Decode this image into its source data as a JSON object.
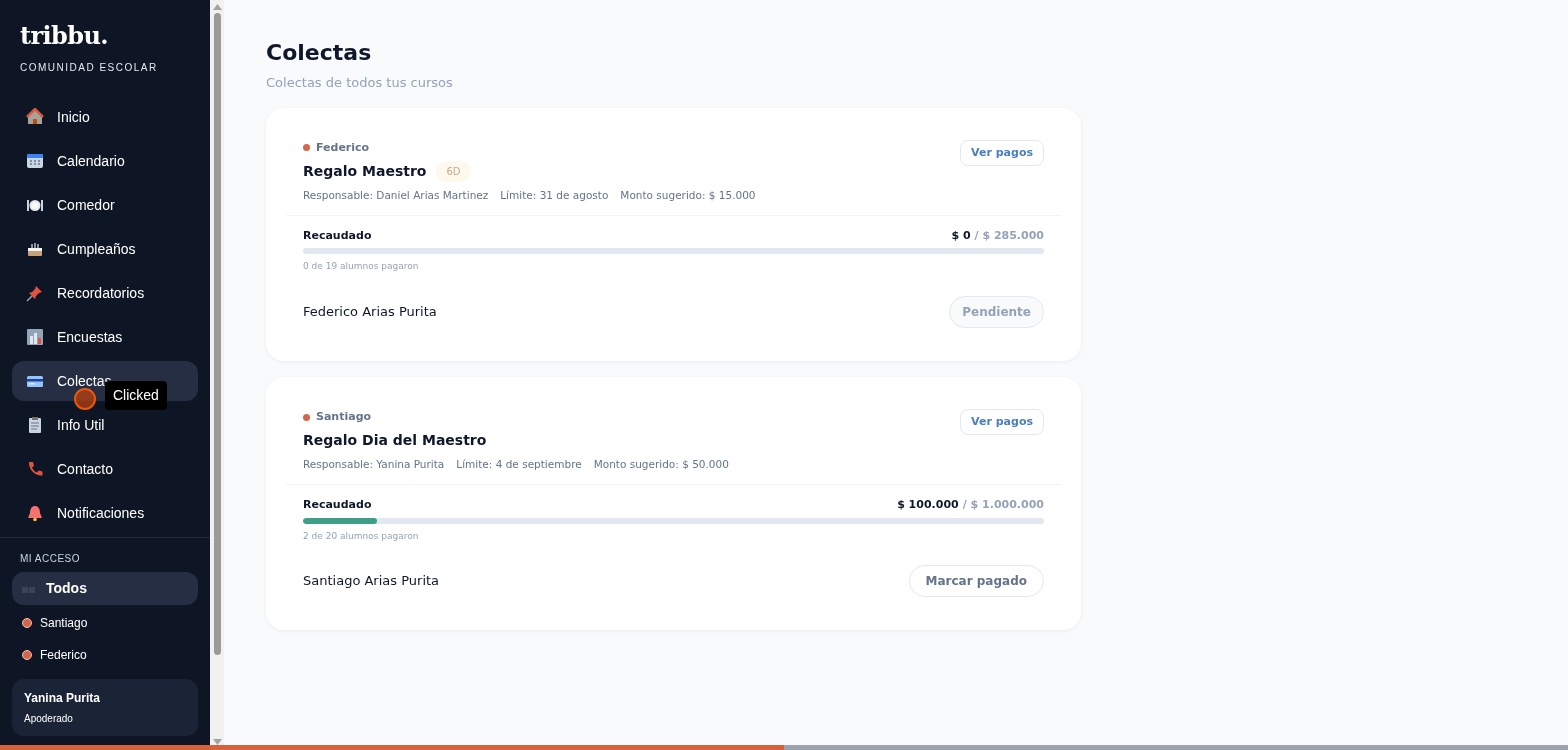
{
  "sidebar": {
    "logo": "tribbu.",
    "tagline": "COMUNIDAD ESCOLAR",
    "nav_items": [
      {
        "label": "Inicio",
        "selected": false
      },
      {
        "label": "Calendario",
        "selected": false
      },
      {
        "label": "Comedor",
        "selected": false
      },
      {
        "label": "Cumpleaños",
        "selected": false
      },
      {
        "label": "Recordatorios",
        "selected": false
      },
      {
        "label": "Encuestas",
        "selected": false
      },
      {
        "label": "Colectas",
        "selected": true
      },
      {
        "label": "Info Util",
        "selected": false
      },
      {
        "label": "Contacto",
        "selected": false
      },
      {
        "label": "Notificaciones",
        "selected": false
      }
    ],
    "access_heading": "MI ACCESO",
    "access_items": [
      {
        "label": "Todos",
        "selected": true,
        "kind": "all"
      },
      {
        "label": "Santiago",
        "selected": false,
        "kind": "child",
        "color": "#d4674a"
      },
      {
        "label": "Federico",
        "selected": false,
        "kind": "child",
        "color": "#d4674a"
      }
    ],
    "user": {
      "name": "Yanina Purita",
      "role": "Apoderado"
    }
  },
  "click_tooltip": "Clicked",
  "page": {
    "title": "Colectas",
    "subtitle": "Colectas de todos tus cursos"
  },
  "collections": [
    {
      "child": "Federico",
      "color": "#d4674a",
      "title": "Regalo Maestro",
      "badge": "6D",
      "details": [
        "Responsable: Daniel Arias Martinez",
        "Límite: 31 de agosto",
        "Monto sugerido: $ 15.000"
      ],
      "view_button": "Ver pagos",
      "progress_label": "Recaudado",
      "raised": "$ 0",
      "goal": "/ $ 285.000",
      "level": 0,
      "paid_count": "0 de 19 alumnos pagaron",
      "student": "Federico Arias Purita",
      "action": {
        "label": "Pendiente",
        "kind": "status"
      }
    },
    {
      "child": "Santiago",
      "color": "#d4674a",
      "title": "Regalo Dia del Maestro",
      "details": [
        "Responsable: Yanina Purita",
        "Límite: 4 de septiembre",
        "Monto sugerido: $ 50.000"
      ],
      "view_button": "Ver pagos",
      "progress_label": "Recaudado",
      "raised": "$ 100.000",
      "goal": "/ $ 1.000.000",
      "level": 0.1,
      "paid_count": "2 de 20 alumnos pagaron",
      "student": "Santiago Arias Purita",
      "action": {
        "label": "Marcar pagado",
        "kind": "action"
      }
    }
  ],
  "load_bar": {
    "level": 0.5
  }
}
